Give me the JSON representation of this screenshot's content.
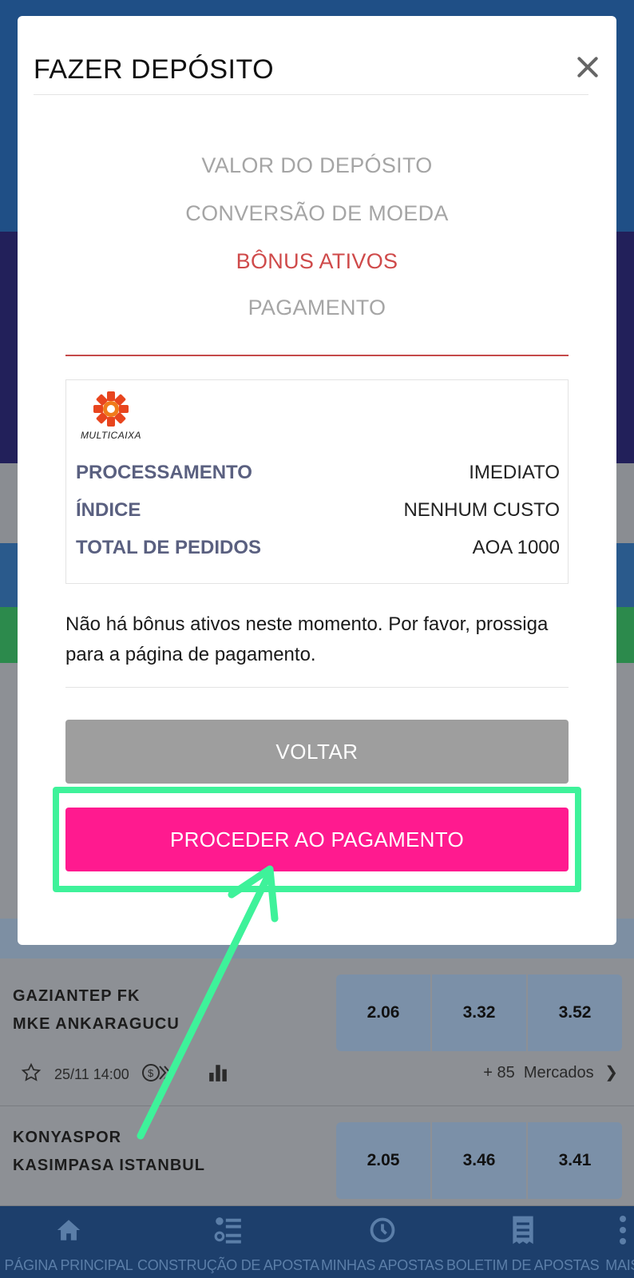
{
  "modal": {
    "title": "FAZER DEPÓSITO",
    "steps": [
      {
        "label": "VALOR DO DEPÓSITO",
        "active": false
      },
      {
        "label": "CONVERSÃO DE MOEDA",
        "active": false
      },
      {
        "label": "BÔNUS ATIVOS",
        "active": true
      },
      {
        "label": "PAGAMENTO",
        "active": false
      }
    ],
    "payment_method": {
      "logo_icon": "multicaixa-logo",
      "rows": [
        {
          "key": "PROCESSAMENTO",
          "value": "IMEDIATO"
        },
        {
          "key": "ÍNDICE",
          "value": "NENHUM CUSTO"
        },
        {
          "key": "TOTAL DE PEDIDOS",
          "value": "AOA 1000"
        }
      ]
    },
    "message": "Não há bônus ativos neste momento. Por favor, prossiga para a página de pagamento.",
    "back_label": "VOLTAR",
    "pay_label": "PROCEDER AO PAGAMENTO"
  },
  "matches": [
    {
      "home": "GAZIANTEP FK",
      "away": "MKE ANKARAGUCU",
      "odds": [
        "2.06",
        "3.32",
        "3.52"
      ],
      "datetime": "25/11 14:00",
      "markets": "+ 85  Mercados"
    },
    {
      "home": "KONYASPOR",
      "away": "KASIMPASA ISTANBUL",
      "odds": [
        "2.05",
        "3.46",
        "3.41"
      ]
    }
  ],
  "bottom_nav": [
    {
      "label": "PÁGINA PRINCIPAL",
      "icon": "home-icon"
    },
    {
      "label": "CONSTRUÇÃO DE APOSTA",
      "icon": "list-builder-icon"
    },
    {
      "label": "MINHAS APOSTAS",
      "icon": "history-icon"
    },
    {
      "label": "BOLETIM DE APOSTAS",
      "icon": "receipt-icon"
    },
    {
      "label": "MAIS",
      "icon": "more-icon"
    }
  ],
  "colors": {
    "accent_active_step": "#cf4a4a",
    "pay_button": "#ff1a8f",
    "highlight": "#3ef29a"
  }
}
